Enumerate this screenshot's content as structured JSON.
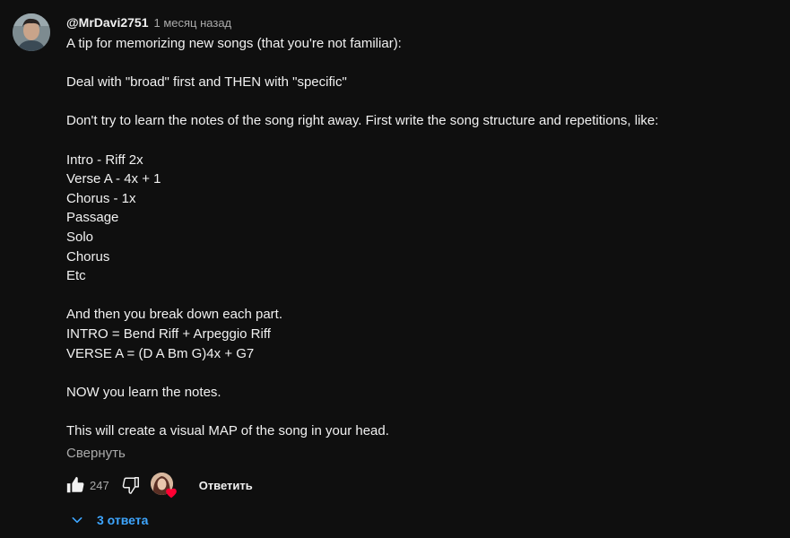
{
  "comment": {
    "author": "@MrDavi2751",
    "published": "1 месяц назад",
    "lines": [
      "A tip for memorizing new songs (that you're not familiar):",
      "",
      "Deal with \"broad\" first and THEN with \"specific\"",
      "",
      "Don't try to learn the notes of the song right away. First write the song structure and repetitions, like:",
      "",
      "Intro - Riff 2x",
      "Verse A - 4x + 1",
      "Chorus - 1x",
      "Passage",
      "Solo",
      "Chorus",
      "Etc",
      "",
      "And then you break down each part.",
      "INTRO = Bend Riff + Arpeggio Riff",
      "VERSE A = (D A Bm G)4x + G7",
      "",
      "NOW you learn the notes.",
      "",
      "This will create a visual MAP of the song in your head."
    ],
    "collapse_label": "Свернуть",
    "like_count": "247",
    "reply_label": "Ответить",
    "replies_label": "3 ответа"
  },
  "colors": {
    "background": "#0f0f0f",
    "text": "#f1f1f1",
    "secondary": "#aaaaaa",
    "link": "#3ea6ff",
    "heart": "#ff0033"
  },
  "icons": {
    "like": "thumbs-up-icon",
    "dislike": "thumbs-down-icon",
    "heart": "heart-icon",
    "expand": "chevron-down-icon"
  }
}
